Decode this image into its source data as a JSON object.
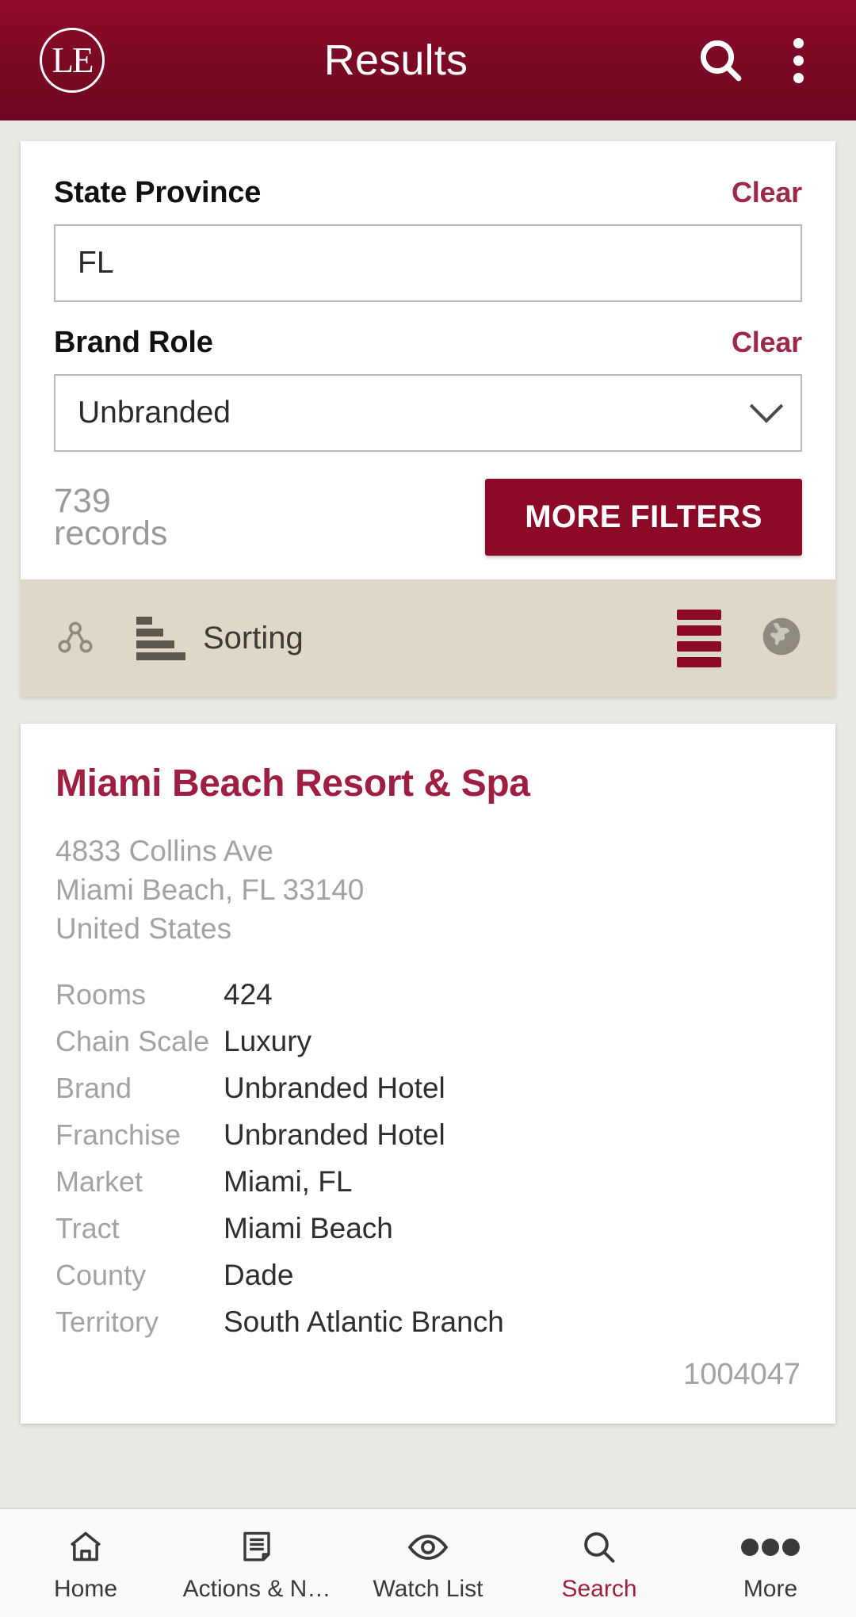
{
  "header": {
    "logo_text": "LE",
    "logo_icon": "le-circle-logo",
    "title": "Results",
    "search_icon": "search-icon",
    "overflow_icon": "kebab-menu-icon"
  },
  "filters": {
    "state_province": {
      "label": "State Province",
      "clear_label": "Clear",
      "value": "FL"
    },
    "brand_role": {
      "label": "Brand Role",
      "clear_label": "Clear",
      "value": "Unbranded",
      "dropdown_icon": "chevron-down-icon"
    },
    "records_number": "739",
    "records_word": "records",
    "more_filters_label": "MORE FILTERS"
  },
  "sorting_bar": {
    "group_icon": "grouping-nodes-icon",
    "sort_icon": "sort-ascending-icon",
    "sorting_label": "Sorting",
    "list_view_icon": "list-view-icon",
    "map_view_icon": "globe-map-icon"
  },
  "result": {
    "title": "Miami Beach Resort & Spa",
    "address": [
      "4833 Collins Ave",
      "Miami Beach, FL 33140",
      "United States"
    ],
    "details": [
      {
        "label": "Rooms",
        "value": "424"
      },
      {
        "label": "Chain Scale",
        "value": "Luxury"
      },
      {
        "label": "Brand",
        "value": "Unbranded Hotel"
      },
      {
        "label": "Franchise",
        "value": "Unbranded Hotel"
      },
      {
        "label": "Market",
        "value": "Miami, FL"
      },
      {
        "label": "Tract",
        "value": "Miami Beach"
      },
      {
        "label": "County",
        "value": "Dade"
      },
      {
        "label": "Territory",
        "value": "South Atlantic Branch"
      }
    ],
    "record_id": "1004047"
  },
  "tabbar": {
    "items": [
      {
        "label": "Home",
        "icon": "home-icon",
        "active": false
      },
      {
        "label": "Actions & N…",
        "icon": "document-icon",
        "active": false
      },
      {
        "label": "Watch List",
        "icon": "eye-icon",
        "active": false
      },
      {
        "label": "Search",
        "icon": "search-icon",
        "active": true
      },
      {
        "label": "More",
        "icon": "ellipsis-icon",
        "active": false
      }
    ]
  },
  "colors": {
    "brand_dark_red": "#7a0a24",
    "accent_crimson": "#9e1f42",
    "button_red": "#8c0a28",
    "page_bg": "#e9e8e3",
    "sorting_bar_bg": "#ddd8c8"
  }
}
